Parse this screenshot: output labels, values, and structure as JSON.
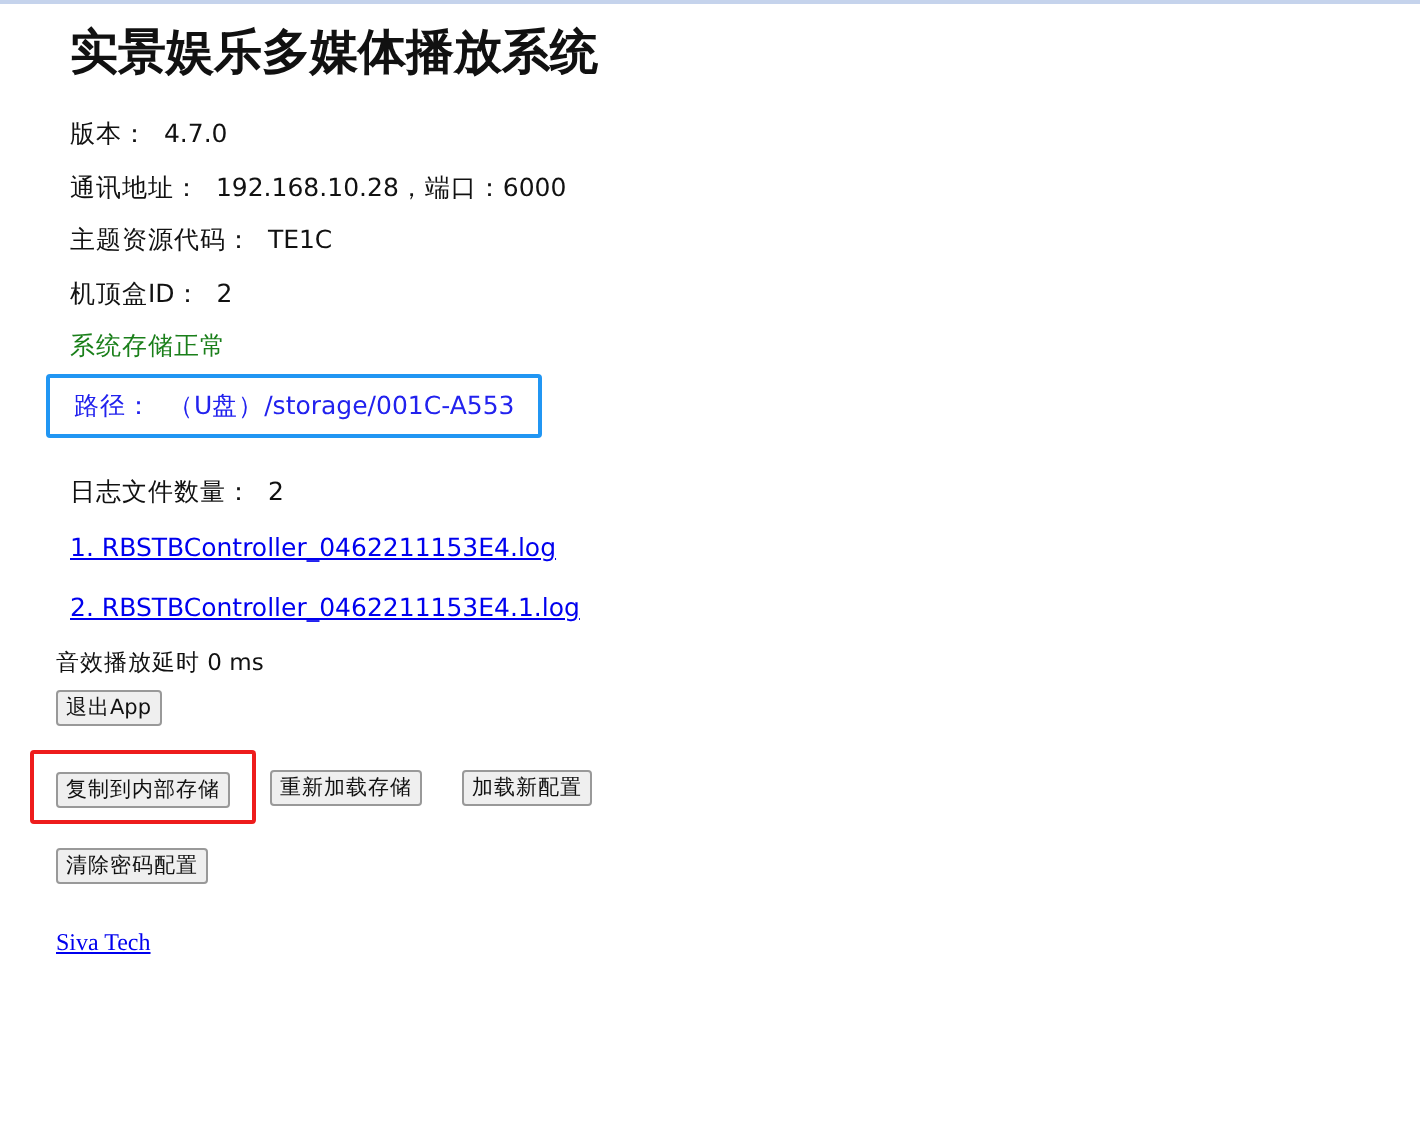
{
  "title": "实景娱乐多媒体播放系统",
  "info": [
    {
      "label": "版本：",
      "value": "4.7.0"
    },
    {
      "label": "通讯地址：",
      "value": "192.168.10.28，端口：6000"
    },
    {
      "label": "主题资源代码：",
      "value": "TE1C"
    },
    {
      "label": "机顶盒ID：",
      "value": "2"
    }
  ],
  "storage_status": "系统存储正常",
  "path": {
    "label": "路径：",
    "value": "（U盘）/storage/001C-A553",
    "color": "#2196f3"
  },
  "log_count": {
    "label": "日志文件数量：",
    "value": "2"
  },
  "log_files": [
    "1. RBSTBController_0462211153E4.log",
    "2. RBSTBController_0462211153E4.1.log"
  ],
  "audio_delay": "音效播放延时 0 ms",
  "button_rows": [
    [
      {
        "label": "退出App"
      }
    ],
    [
      {
        "label": "复制到内部存储",
        "color": "#ee1c1c"
      },
      {
        "label": "重新加载存储"
      },
      {
        "label": "加载新配置"
      }
    ],
    [
      {
        "label": "清除密码配置"
      }
    ]
  ],
  "footer_link": "Siva Tech"
}
